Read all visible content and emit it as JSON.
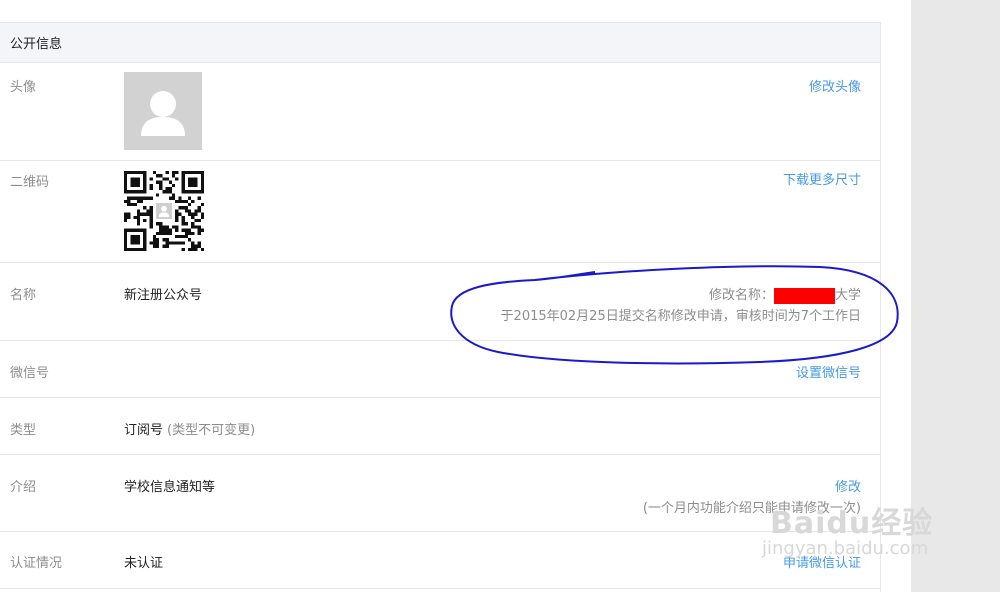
{
  "panel": {
    "title": "公开信息"
  },
  "rows": {
    "avatar": {
      "label": "头像",
      "action": "修改头像"
    },
    "qrcode": {
      "label": "二维码",
      "action": "下载更多尺寸"
    },
    "name": {
      "label": "名称",
      "value": "新注册公众号",
      "change_prefix": "修改名称：",
      "change_suffix": "大学",
      "change_note": "于2015年02月25日提交名称修改申请，审核时间为7个工作日"
    },
    "wechat_id": {
      "label": "微信号",
      "action": "设置微信号"
    },
    "type": {
      "label": "类型",
      "value": "订阅号",
      "note": "(类型不可变更)"
    },
    "intro": {
      "label": "介绍",
      "value": "学校信息通知等",
      "action": "修改",
      "note": "(一个月内功能介绍只能申请修改一次)"
    },
    "verification": {
      "label": "认证情况",
      "value": "未认证",
      "action": "申请微信认证"
    }
  },
  "watermark": {
    "main": "Baidu经验",
    "sub": "jingyan.baidu.com"
  },
  "colors": {
    "link": "#459ae9",
    "muted": "#8d8d8d",
    "header_bg": "#f4f5f9",
    "redact": "#ff0000",
    "annotation": "#1a1acc"
  },
  "icons": {
    "avatar_placeholder": "person-silhouette",
    "qr": "qr-code"
  }
}
